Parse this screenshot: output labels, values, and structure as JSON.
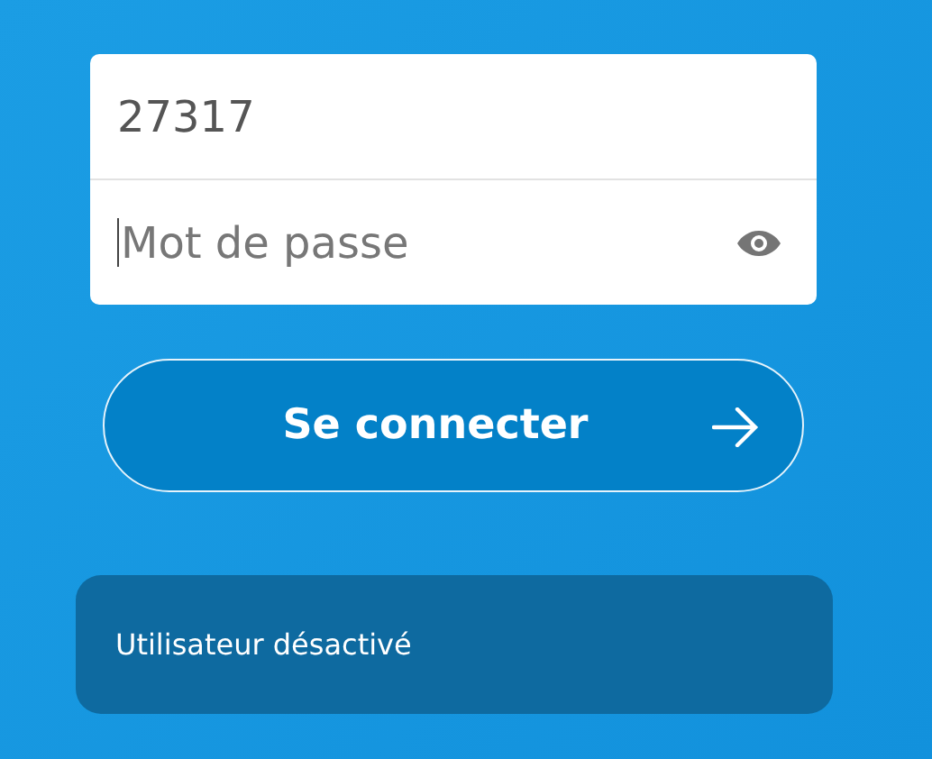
{
  "login_form": {
    "username": {
      "value": "27317"
    },
    "password": {
      "placeholder": "Mot de passe",
      "focused": true
    },
    "submit_button": {
      "label": "Se connecter"
    }
  },
  "message": {
    "text": "Utilisateur désactivé"
  }
}
